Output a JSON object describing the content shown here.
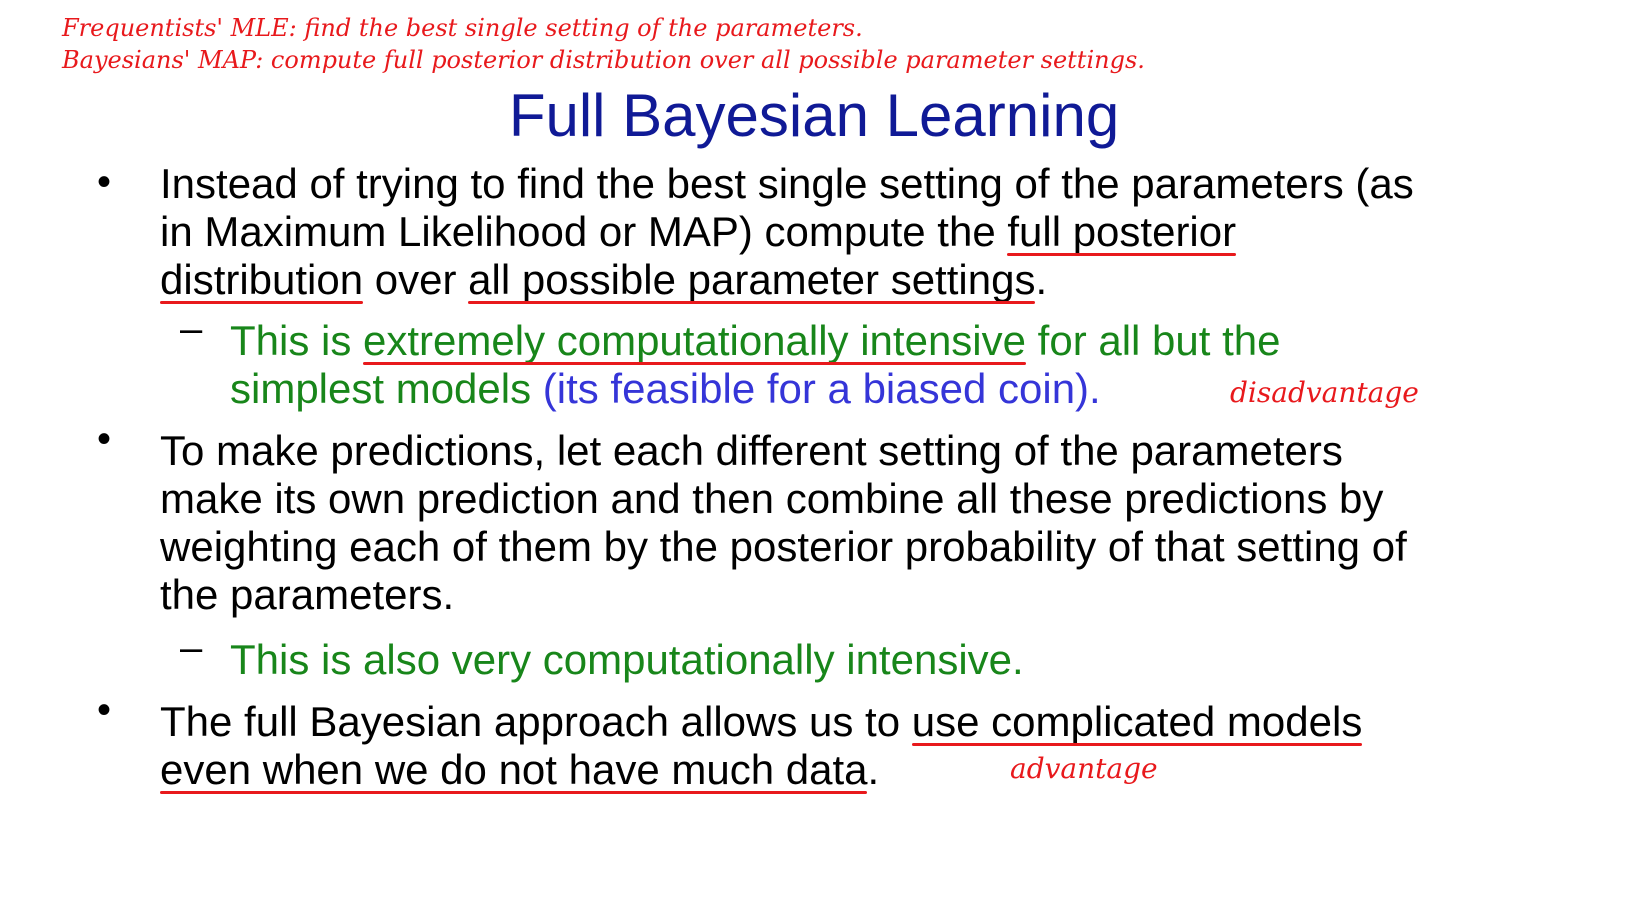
{
  "annotations": {
    "mle_note": "Frequentists' MLE: find the best single setting of the parameters.",
    "map_note": "Bayesians' MAP: compute full posterior distribution over all possible parameter settings.",
    "disadvantage": "disadvantage",
    "advantage": "advantage"
  },
  "title": "Full Bayesian Learning",
  "bullet_marker": "•",
  "sub_marker": "–",
  "bullets": [
    {
      "line1": "Instead of trying to find the best single setting of the parameters (as",
      "line2_pre": "in Maximum Likelihood or MAP) compute the ",
      "line2_ul": "full posterior",
      "line3_ul1": "distribution",
      "line3_mid": " over ",
      "line3_ul2": "all possible parameter settings",
      "line3_end": "."
    },
    {
      "line1": "To make predictions, let each different setting of the parameters",
      "line2": "make its own prediction and then combine all these predictions by",
      "line3": "weighting each of them by the posterior probability of that setting of",
      "line4": "the parameters."
    },
    {
      "line1_pre": "The full Bayesian approach allows us to ",
      "line1_ul": "use complicated models",
      "line2_ul": "even when we do not have much data",
      "line2_end": "."
    }
  ],
  "subbullets": [
    {
      "line1_pre": "This is ",
      "line1_ul": "extremely computationally intensive",
      "line1_post": " for all but the",
      "line2_green": "simplest models ",
      "line2_blue": "(its feasible for a biased coin)."
    },
    {
      "text": "This is also very computationally intensive."
    }
  ],
  "colors": {
    "title": "#101a96",
    "annotation_red": "#e8191c",
    "sub_green": "#18861a",
    "sub_blue": "#3535d8"
  }
}
